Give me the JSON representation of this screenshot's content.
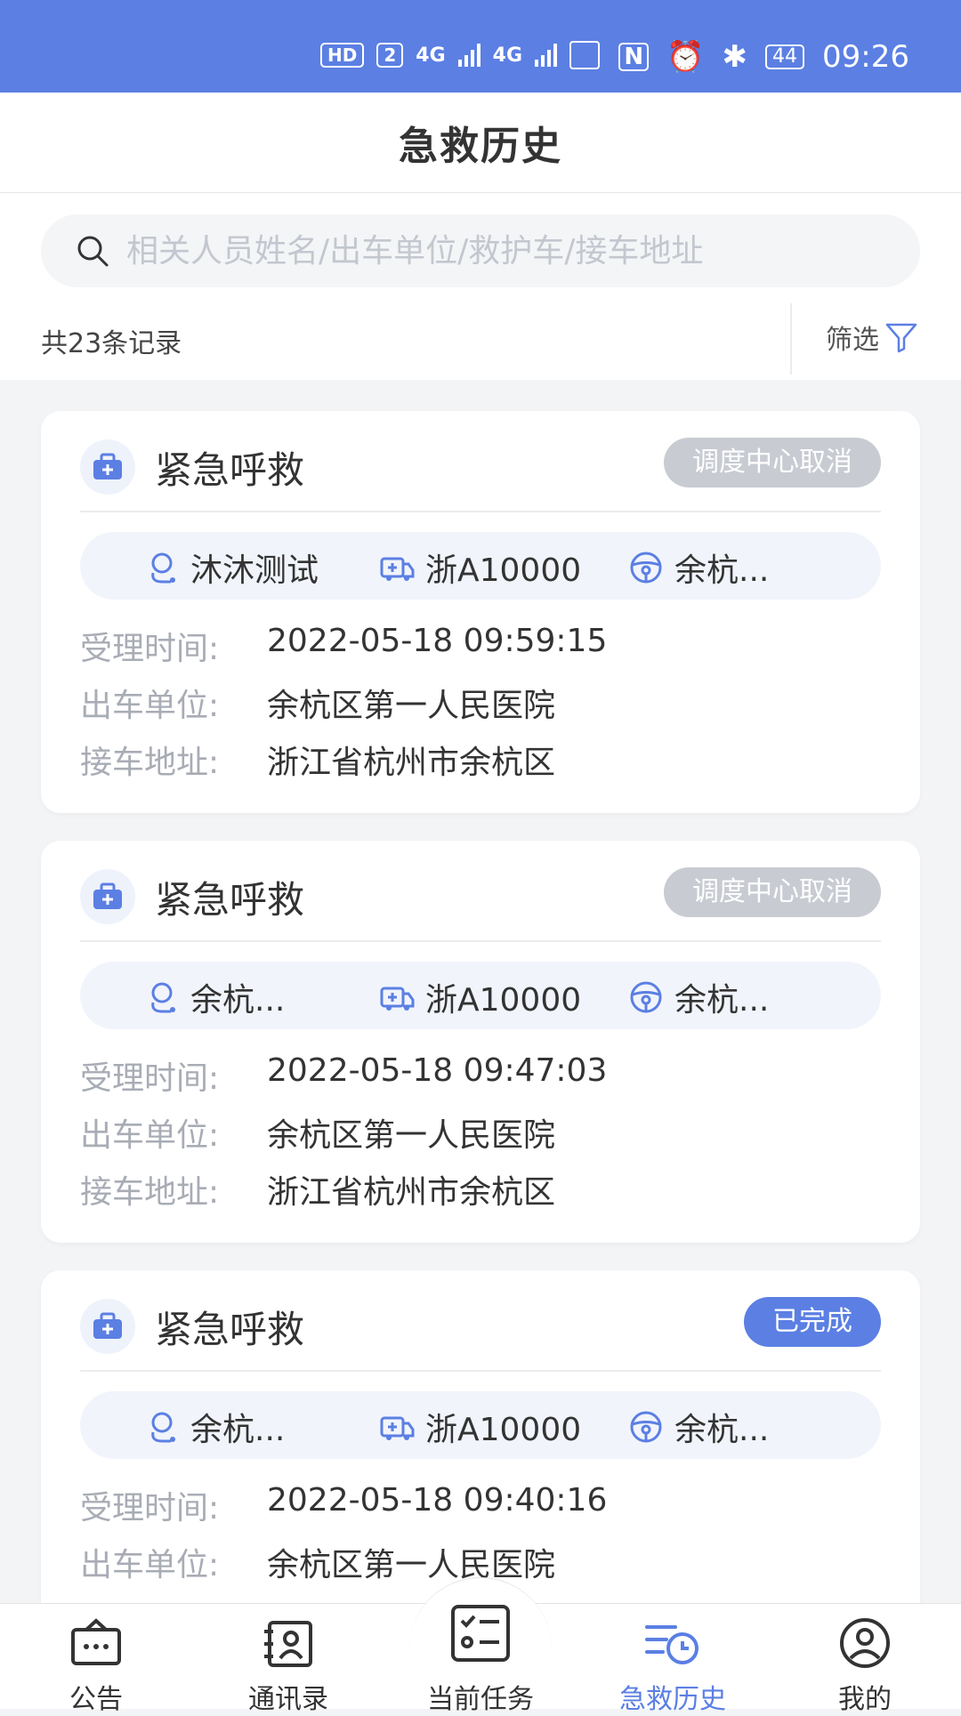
{
  "status_bar": {
    "hd": "HD",
    "sim": "2",
    "net1": "4G",
    "net2": "4G",
    "battery": "44",
    "time": "09:26"
  },
  "header": {
    "title": "急救历史"
  },
  "search": {
    "placeholder": "相关人员姓名/出车单位/救护车/接车地址",
    "value": ""
  },
  "summary": {
    "count_text": "共23条记录",
    "filter_label": "筛选"
  },
  "labels": {
    "accept_time": "受理时间:",
    "unit": "出车单位:",
    "address": "接车地址:"
  },
  "records": [
    {
      "type": "紧急呼救",
      "status": "调度中心取消",
      "doctor": "沐沐测试",
      "vehicle": "浙A10000",
      "driver": "余杭...",
      "accept_time": "2022-05-18 09:59:15",
      "unit": "余杭区第一人民医院",
      "address": "浙江省杭州市余杭区"
    },
    {
      "type": "紧急呼救",
      "status": "调度中心取消",
      "doctor": "余杭...",
      "vehicle": "浙A10000",
      "driver": "余杭...",
      "accept_time": "2022-05-18 09:47:03",
      "unit": "余杭区第一人民医院",
      "address": "浙江省杭州市余杭区"
    },
    {
      "type": "紧急呼救",
      "status": "已完成",
      "doctor": "余杭...",
      "vehicle": "浙A10000",
      "driver": "余杭...",
      "accept_time": "2022-05-18 09:40:16",
      "unit": "余杭区第一人民医院"
    }
  ],
  "tabs": [
    {
      "label": "公告",
      "icon": "announcement-icon"
    },
    {
      "label": "通讯录",
      "icon": "contacts-icon"
    },
    {
      "label": "当前任务",
      "icon": "task-list-icon"
    },
    {
      "label": "急救历史",
      "icon": "history-icon",
      "active": true
    },
    {
      "label": "我的",
      "icon": "profile-icon"
    }
  ],
  "colors": {
    "primary": "#5b7fe3",
    "status_cancel": "#c8cbd2",
    "background": "#f3f4f6"
  }
}
